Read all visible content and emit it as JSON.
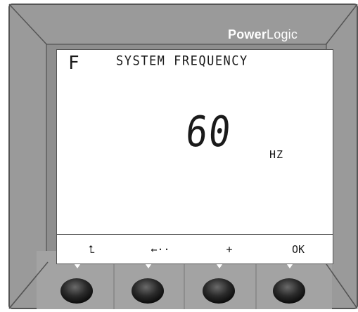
{
  "brand": {
    "name_bold": "Power",
    "name_light": "Logic"
  },
  "display": {
    "screen_code": "F",
    "title": "SYSTEM FREQUENCY",
    "value": "60",
    "unit": "HZ"
  },
  "softkeys": [
    "⮤",
    "←··",
    "+",
    "OK"
  ],
  "colors": {
    "bezel": "#9a9a9a",
    "bezel_dark": "#6b6b6b",
    "lcd": "#ffffff",
    "button": "#2b2b2b"
  }
}
